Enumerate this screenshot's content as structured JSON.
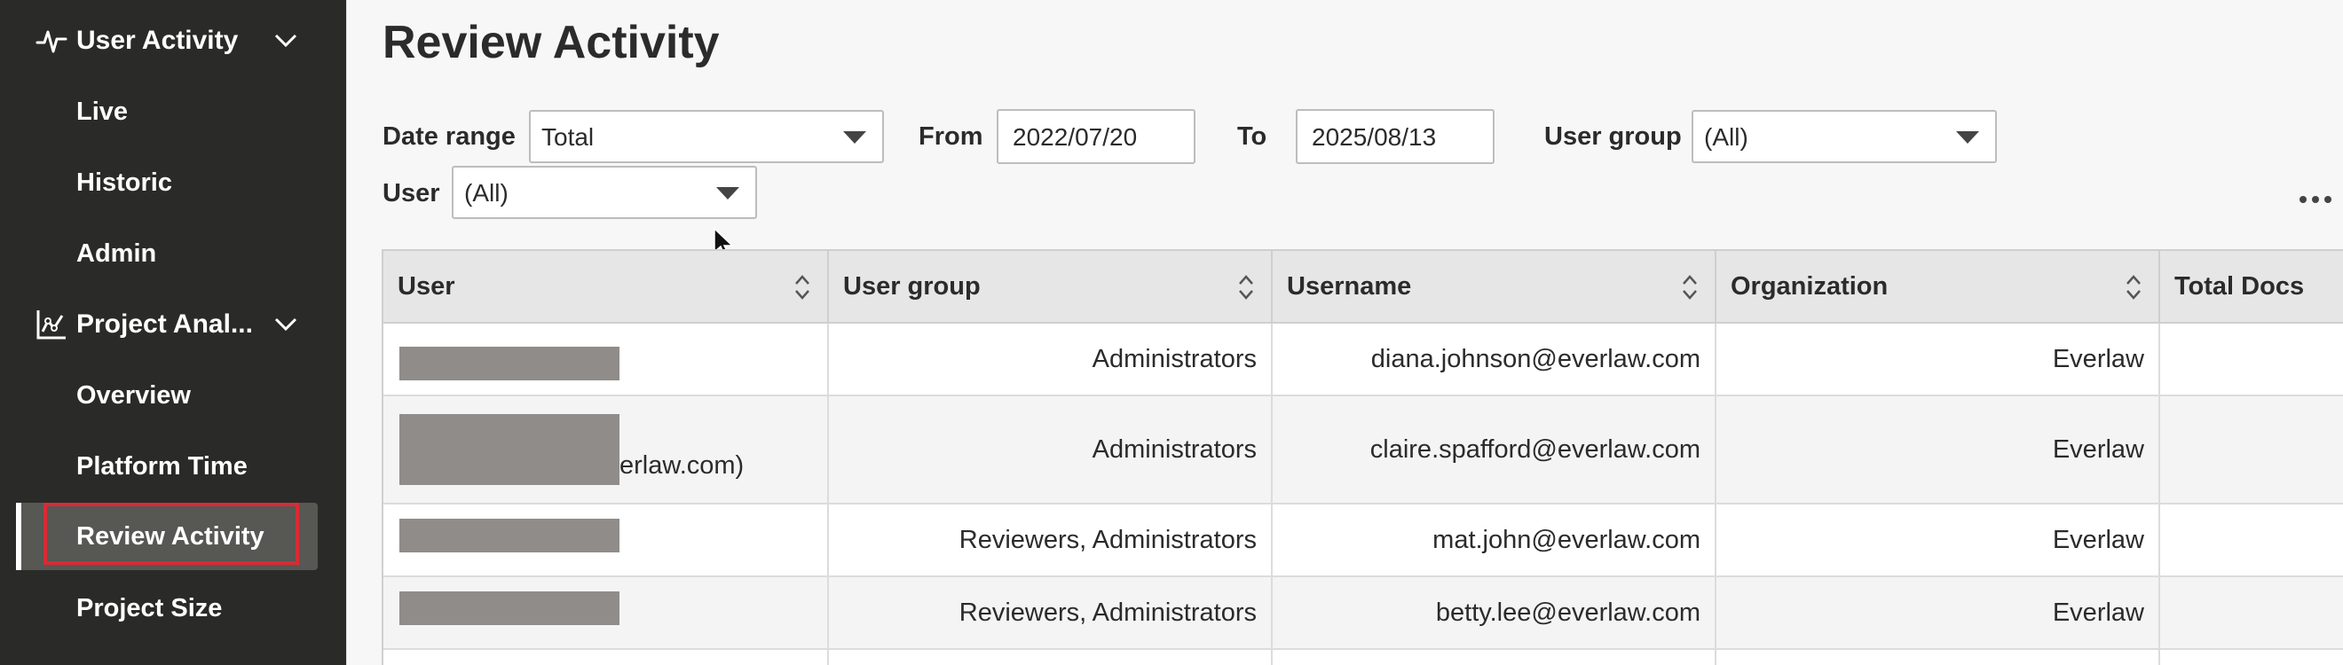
{
  "sidebar": {
    "sections": [
      {
        "label": "User Activity",
        "icon": "activity-pulse-icon"
      },
      {
        "label": "Project Anal...",
        "icon": "chart-analytics-icon"
      }
    ],
    "user_activity_items": [
      {
        "label": "Live"
      },
      {
        "label": "Historic"
      },
      {
        "label": "Admin"
      }
    ],
    "project_analytics_items": [
      {
        "label": "Overview"
      },
      {
        "label": "Platform Time"
      },
      {
        "label": "Review Activity",
        "active": true
      },
      {
        "label": "Project Size"
      }
    ]
  },
  "main": {
    "title": "Review Activity",
    "filters": {
      "date_range_label": "Date range",
      "date_range_value": "Total",
      "from_label": "From",
      "from_value": "2022/07/20",
      "to_label": "To",
      "to_value": "2025/08/13",
      "user_group_label": "User group",
      "user_group_value": "(All)",
      "user_label": "User",
      "user_value": "(All)"
    },
    "more_menu_icon": "ellipsis-icon"
  },
  "table": {
    "columns": [
      {
        "label": "User"
      },
      {
        "label": "User group"
      },
      {
        "label": "Username"
      },
      {
        "label": "Organization"
      },
      {
        "label": "Total Docs"
      }
    ],
    "rows": [
      {
        "user_redacted": true,
        "user_suffix": "",
        "user_group": "Administrators",
        "username": "diana.johnson@everlaw.com",
        "organization": "Everlaw",
        "total_docs": ""
      },
      {
        "user_redacted": true,
        "user_suffix": "erlaw.com)",
        "user_group": "Administrators",
        "username": "claire.spafford@everlaw.com",
        "organization": "Everlaw",
        "total_docs": ""
      },
      {
        "user_redacted": true,
        "user_suffix": "",
        "user_group": "Reviewers, Administrators",
        "username": "mat.john@everlaw.com",
        "organization": "Everlaw",
        "total_docs": ""
      },
      {
        "user_redacted": true,
        "user_suffix": "",
        "user_group": "Reviewers, Administrators",
        "username": "betty.lee@everlaw.com",
        "organization": "Everlaw",
        "total_docs": ""
      }
    ]
  },
  "colors": {
    "sidebar_bg": "#2a2a28",
    "active_item_bg": "#575754",
    "highlight_border": "#d92b34",
    "redaction": "#8f8c89"
  }
}
